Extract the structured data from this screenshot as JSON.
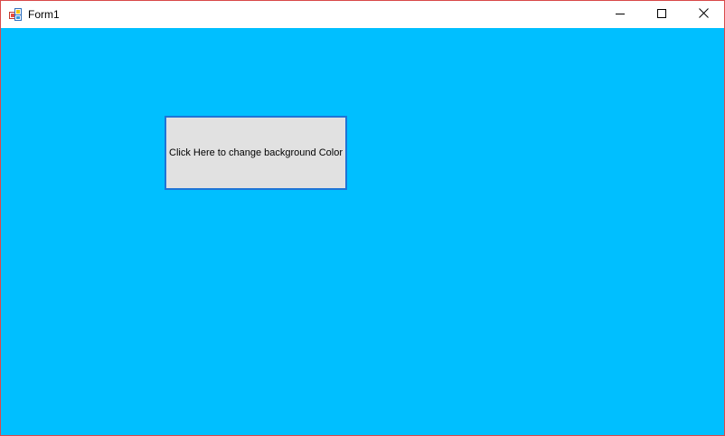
{
  "window": {
    "title": "Form1",
    "icon": "winforms-app-icon",
    "border_color": "#d94a4a",
    "controls": {
      "minimize_icon": "minimize-icon",
      "maximize_icon": "maximize-icon",
      "close_icon": "close-icon"
    }
  },
  "client": {
    "background_color": "#00bfff"
  },
  "button": {
    "label": "Click Here to change background Color",
    "background_color": "#e1e1e1",
    "border_color": "#1e74d6"
  }
}
